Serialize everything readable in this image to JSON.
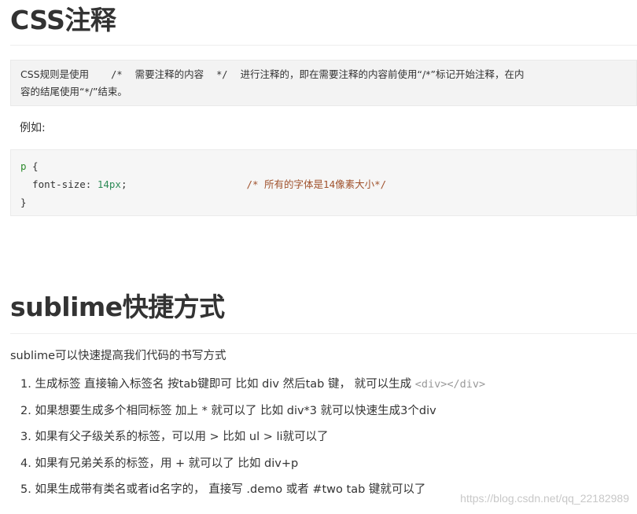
{
  "section1": {
    "title": "CSS注释",
    "blockquote": {
      "part1": "CSS规则是使用",
      "code1": "/*",
      "part2": "需要注释的内容",
      "code2": "*/",
      "part3": "进行注释的，即在需要注释的内容前使用“/*”标记开始注释，在内",
      "line2": "容的结尾使用“*/”结束。"
    },
    "example_label": "例如:",
    "code": {
      "selector": "p",
      "open_brace": " {",
      "property": "  font-size: ",
      "value": "14px",
      "semicolon": ";",
      "comment": "/* 所有的字体是14像素大小*/",
      "close_brace": "}"
    }
  },
  "section2": {
    "title": "sublime快捷方式",
    "intro": "sublime可以快速提高我们代码的书写方式",
    "items": [
      {
        "text": "1. 生成标签 直接输入标签名 按tab键即可   比如  div   然后tab 键，  就可以生成 ",
        "code": "<div></div>"
      },
      {
        "text": "2. 如果想要生成多个相同标签  加上 * 就可以了 比如   div*3  就可以快速生成3个div"
      },
      {
        "text": "3. 如果有父子级关系的标签，可以用 >  比如   ul > li就可以了"
      },
      {
        "text": "4. 如果有兄弟关系的标签，用  +  就可以了 比如 div+p"
      },
      {
        "text": "5. 如果生成带有类名或者id名字的，   直接写  .demo  或者  #two   tab 键就可以了"
      }
    ]
  },
  "watermark": "https://blog.csdn.net/qq_22182989"
}
